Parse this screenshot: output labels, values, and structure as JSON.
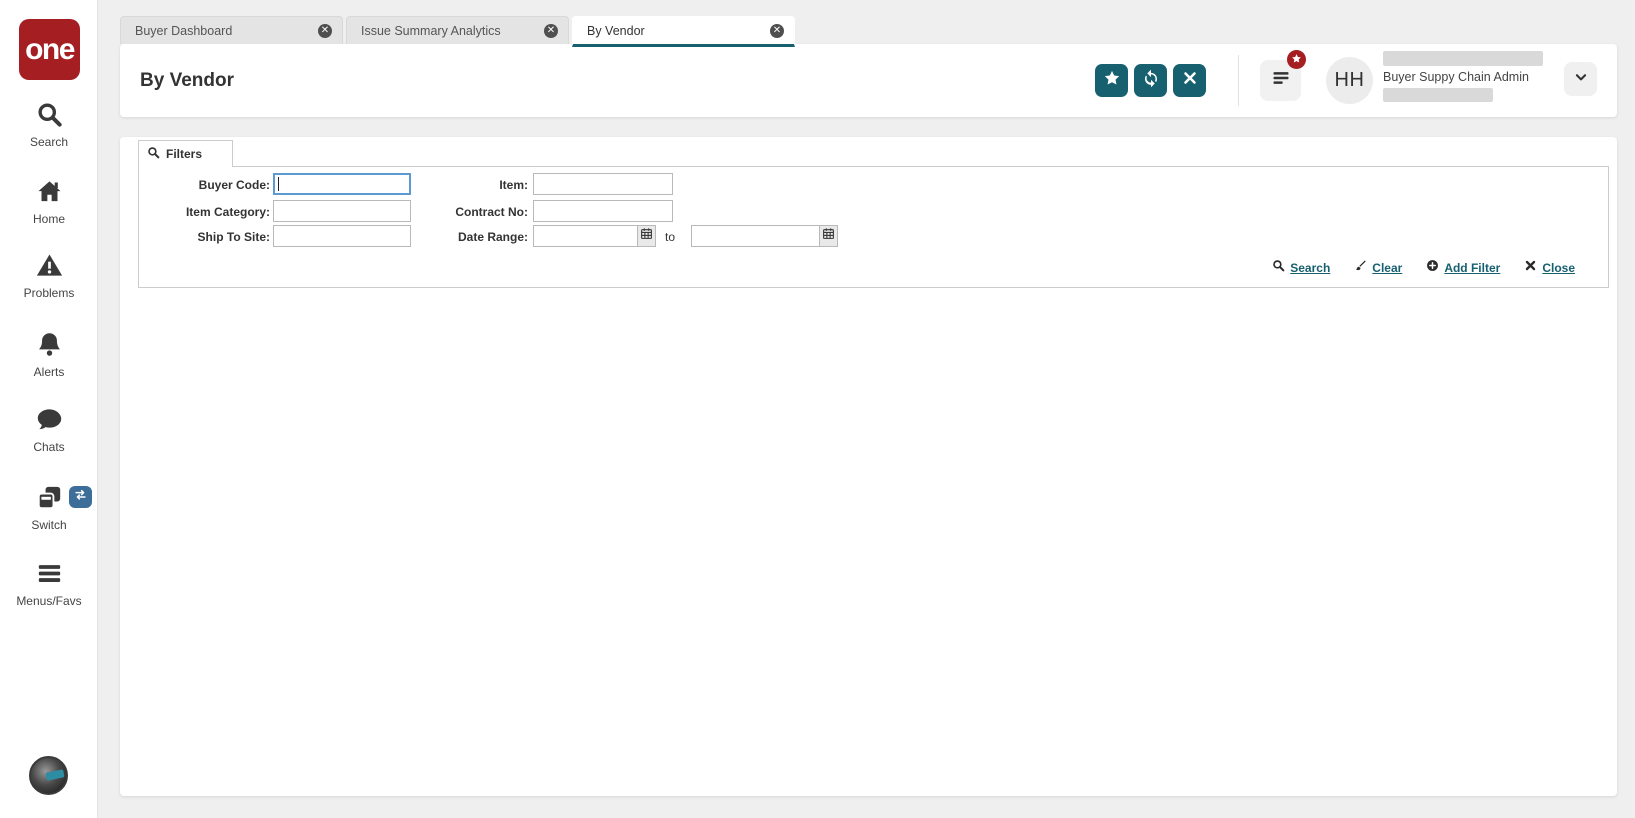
{
  "colors": {
    "accent_teal": "#176070",
    "brand_red": "#a51e22",
    "switch_badge_blue": "#3d6e99",
    "focus_blue": "#5b9bd3",
    "page_background": "#efefef"
  },
  "logo": {
    "text": "one"
  },
  "sidebar": {
    "items": [
      {
        "label": "Search",
        "icon": "search-icon"
      },
      {
        "label": "Home",
        "icon": "home-icon"
      },
      {
        "label": "Problems",
        "icon": "warning-triangle-icon"
      },
      {
        "label": "Alerts",
        "icon": "bell-icon"
      },
      {
        "label": "Chats",
        "icon": "chat-bubble-icon"
      },
      {
        "label": "Switch",
        "icon": "switch-windows-icon"
      },
      {
        "label": "Menus/Favs",
        "icon": "hamburger-icon"
      }
    ]
  },
  "tabbar": {
    "tabs": [
      {
        "label": "Buyer Dashboard",
        "active": false
      },
      {
        "label": "Issue Summary Analytics",
        "active": false
      },
      {
        "label": "By Vendor",
        "active": true
      }
    ]
  },
  "header": {
    "title": "By Vendor",
    "actions": [
      {
        "name": "favorite",
        "icon": "star-icon"
      },
      {
        "name": "refresh",
        "icon": "refresh-icon"
      },
      {
        "name": "close",
        "icon": "close-icon"
      }
    ],
    "user": {
      "initials": "HH",
      "role": "Buyer Suppy Chain Admin"
    }
  },
  "filters": {
    "title": "Filters",
    "fields": {
      "buyer_code": {
        "label": "Buyer Code:",
        "value": "",
        "focused": true
      },
      "item_category": {
        "label": "Item Category:",
        "value": ""
      },
      "ship_to_site": {
        "label": "Ship To Site:",
        "value": ""
      },
      "item": {
        "label": "Item:",
        "value": ""
      },
      "contract_no": {
        "label": "Contract No:",
        "value": ""
      },
      "date_range": {
        "label": "Date Range:",
        "from_value": "",
        "to_label": "to",
        "to_value": ""
      }
    },
    "actions": {
      "search": "Search",
      "clear": "Clear",
      "add_filter": "Add Filter",
      "close": "Close"
    }
  }
}
